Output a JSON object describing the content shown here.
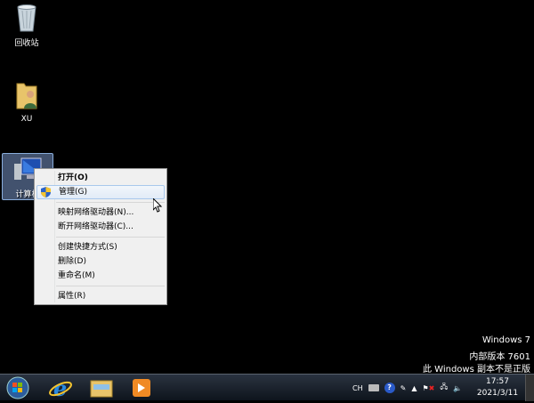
{
  "desktop": {
    "icons": [
      {
        "label": "回收站",
        "icon": "recycle-bin-icon"
      },
      {
        "label": "XU",
        "icon": "user-folder-icon"
      },
      {
        "label": "计算机",
        "icon": "computer-icon"
      }
    ]
  },
  "context_menu": {
    "items": [
      {
        "label": "打开(O)",
        "bold": true
      },
      {
        "label": "管理(G)",
        "icon": "uac-shield-icon",
        "highlighted": true
      },
      {
        "label": "映射网络驱动器(N)..."
      },
      {
        "label": "断开网络驱动器(C)..."
      },
      {
        "label": "创建快捷方式(S)"
      },
      {
        "label": "删除(D)"
      },
      {
        "label": "重命名(M)"
      },
      {
        "label": "属性(R)"
      }
    ]
  },
  "watermark": {
    "line1": "Windows 7",
    "line2": "内部版本 7601",
    "line3": "此 Windows 副本不是正版"
  },
  "taskbar": {
    "pinned": [
      "internet-explorer-icon",
      "file-explorer-icon",
      "media-player-icon"
    ],
    "tray": {
      "language": "CH",
      "icons": [
        "keyboard-icon",
        "help-icon",
        "pen-icon",
        "show-hidden-icon",
        "action-center-flag-icon",
        "network-icon",
        "volume-icon"
      ],
      "time": "17:57",
      "date": "2021/3/11"
    }
  },
  "colors": {
    "highlight": "#e1ebf7",
    "taskbar": "#1a222c"
  }
}
